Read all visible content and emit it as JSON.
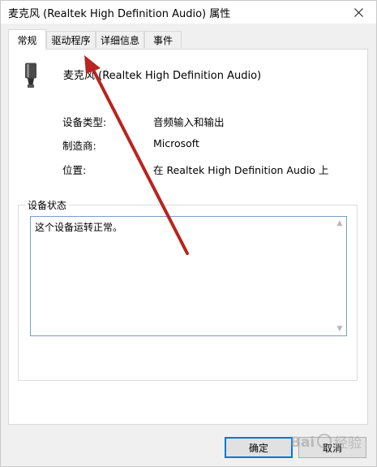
{
  "window": {
    "title": "麦克风 (Realtek High Definition Audio) 属性"
  },
  "tabs": [
    {
      "label": "常规",
      "active": true
    },
    {
      "label": "驱动程序",
      "active": false
    },
    {
      "label": "详细信息",
      "active": false
    },
    {
      "label": "事件",
      "active": false
    }
  ],
  "general": {
    "device_icon": "microphone-icon",
    "device_name": "麦克风 (Realtek High Definition Audio)",
    "properties": [
      {
        "label": "设备类型:",
        "value": "音频输入和输出"
      },
      {
        "label": "制造商:",
        "value": "Microsoft"
      },
      {
        "label": "位置:",
        "value": "在 Realtek High Definition Audio 上"
      }
    ],
    "status_group_title": "设备状态",
    "status_text": "这个设备运转正常。"
  },
  "buttons": {
    "ok_label": "确定",
    "cancel_label": "取消"
  },
  "annotation": {
    "arrow_color": "#b8241f"
  },
  "watermark": {
    "text": "Bai 经验"
  }
}
